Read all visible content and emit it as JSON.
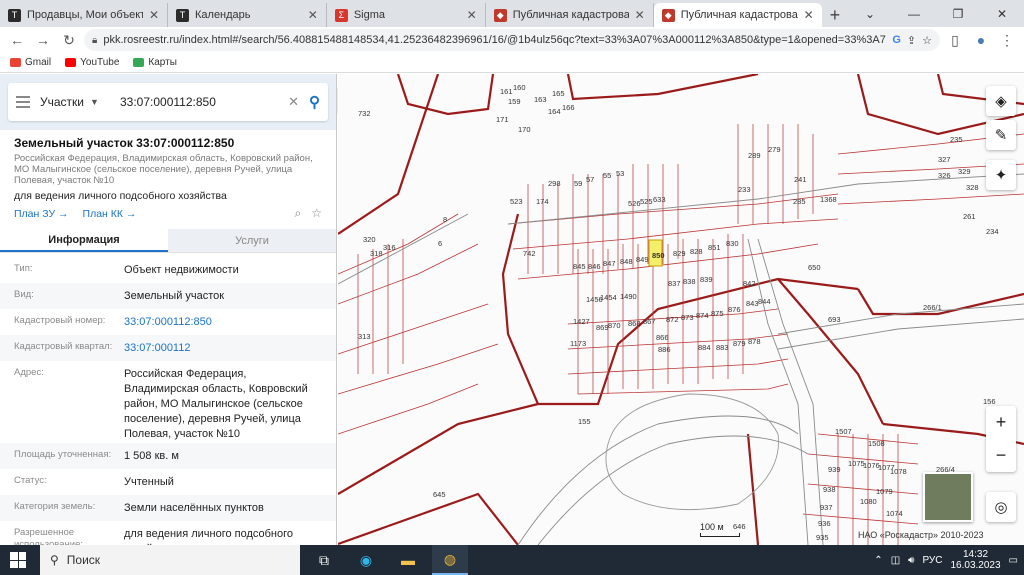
{
  "tabs": [
    {
      "title": "Продавцы, Мои объекты",
      "icon": "dark-app-icon",
      "color": "#2b2b2b"
    },
    {
      "title": "Календарь",
      "icon": "dark-app-icon",
      "color": "#2b2b2b"
    },
    {
      "title": "Sigma",
      "icon": "sigma-icon",
      "color": "#d9352b"
    },
    {
      "title": "Публичная кадастровая кар",
      "icon": "rosreestr-icon",
      "color": "#c0392b"
    },
    {
      "title": "Публичная кадастровая кар",
      "icon": "rosreestr-icon",
      "color": "#c0392b",
      "active": true
    }
  ],
  "toolbar": {
    "url": "pkk.rosreestr.ru/index.html#/search/56.408815488148534,41.25236482396961/16/@1b4ulz56qc?text=33%3A07%3A000112%3A850&type=1&opened=33%3A7%..."
  },
  "bookmarks": [
    {
      "label": "Gmail",
      "color": "#ea4335"
    },
    {
      "label": "YouTube",
      "color": "#ff0000"
    },
    {
      "label": "Карты",
      "color": "#34a853"
    }
  ],
  "search": {
    "type": "Участки",
    "query": "33:07:000112:850"
  },
  "parcel": {
    "title": "Земельный участок 33:07:000112:850",
    "address_short": "Российская Федерация, Владимирская область, Ковровский район, МО Малыгинское (сельское поселение), деревня Ручей, улица Полевая, участок №10",
    "purpose": "для ведения личного подсобного хозяйства",
    "link_zu": "План ЗУ →",
    "link_kk": "План КК →"
  },
  "info_tabs": {
    "info": "Информация",
    "services": "Услуги"
  },
  "properties": [
    {
      "label": "Тип:",
      "value": "Объект недвижимости"
    },
    {
      "label": "Вид:",
      "value": "Земельный участок"
    },
    {
      "label": "Кадастровый номер:",
      "value": "33:07:000112:850",
      "link": true
    },
    {
      "label": "Кадастровый квартал:",
      "value": "33:07:000112",
      "link": true
    },
    {
      "label": "Адрес:",
      "value": "Российская Федерация, Владимирская область, Ковровский район, МО Малыгинское (сельское поселение), деревня Ручей, улица Полевая, участок №10"
    },
    {
      "label": "Площадь уточненная:",
      "value": "1 508 кв. м"
    },
    {
      "label": "Статус:",
      "value": "Учтенный"
    },
    {
      "label": "Категория земель:",
      "value": "Земли населённых пунктов"
    },
    {
      "label": "Разрешенное использование:",
      "value": "для ведения личного подсобного хозяйства"
    }
  ],
  "map": {
    "labels": [
      "742",
      "845",
      "846",
      "847",
      "848",
      "849",
      "850",
      "829",
      "828",
      "851",
      "830",
      "650",
      "155",
      "645",
      "646",
      "886",
      "884",
      "883",
      "879",
      "878",
      "693",
      "266/1",
      "266/4",
      "156",
      "1507",
      "1508",
      "1075",
      "1076",
      "1077",
      "1078",
      "1079",
      "1080",
      "1074",
      "939",
      "938",
      "937",
      "936",
      "935",
      "327",
      "326",
      "329",
      "328",
      "261",
      "234",
      "235",
      "732",
      "320",
      "318",
      "316",
      "313",
      "170",
      "171",
      "159",
      "160",
      "161",
      "163",
      "164",
      "165",
      "166",
      "8",
      "6",
      "59",
      "57",
      "55",
      "53",
      "298",
      "174",
      "523",
      "526",
      "525",
      "633",
      "289",
      "279",
      "233",
      "241",
      "285",
      "1368",
      "1490",
      "1427",
      "1173",
      "1456",
      "1454",
      "837",
      "838",
      "839",
      "872",
      "873",
      "874",
      "875",
      "876",
      "842",
      "843",
      "844",
      "870",
      "869",
      "868",
      "867",
      "866"
    ],
    "highlight": "850",
    "scale_label": "100 м",
    "copyright": "НАО «Роскадастр» 2010-2023"
  },
  "taskbar": {
    "search_placeholder": "Поиск",
    "lang": "РУС",
    "time": "14:32",
    "date": "16.03.2023"
  }
}
